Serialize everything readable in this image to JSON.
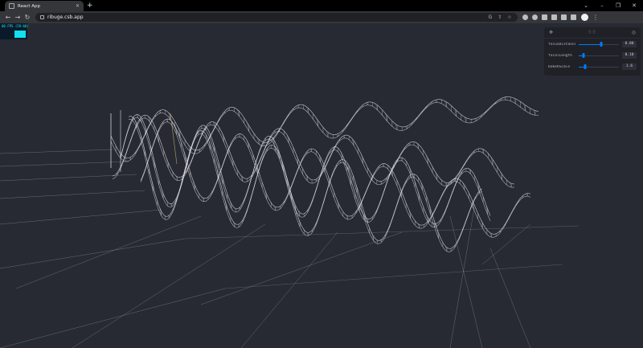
{
  "browser": {
    "tab_title": "React App",
    "url": "ribuge.csb.app"
  },
  "fps_meter": {
    "label": "60 FPS (59-60)",
    "graph_color": "#10e0f0"
  },
  "controls": {
    "rows": [
      {
        "label": "focusDistance",
        "value": "0.00",
        "fraction": 0.55
      },
      {
        "label": "focalLength",
        "value": "0.10",
        "fraction": 0.12
      },
      {
        "label": "bokehScale",
        "value": "1.6",
        "fraction": 0.16
      }
    ]
  },
  "colors": {
    "scene_background": "#272a33",
    "wireframe": "#e8e8ee",
    "accent": "#007bff"
  }
}
